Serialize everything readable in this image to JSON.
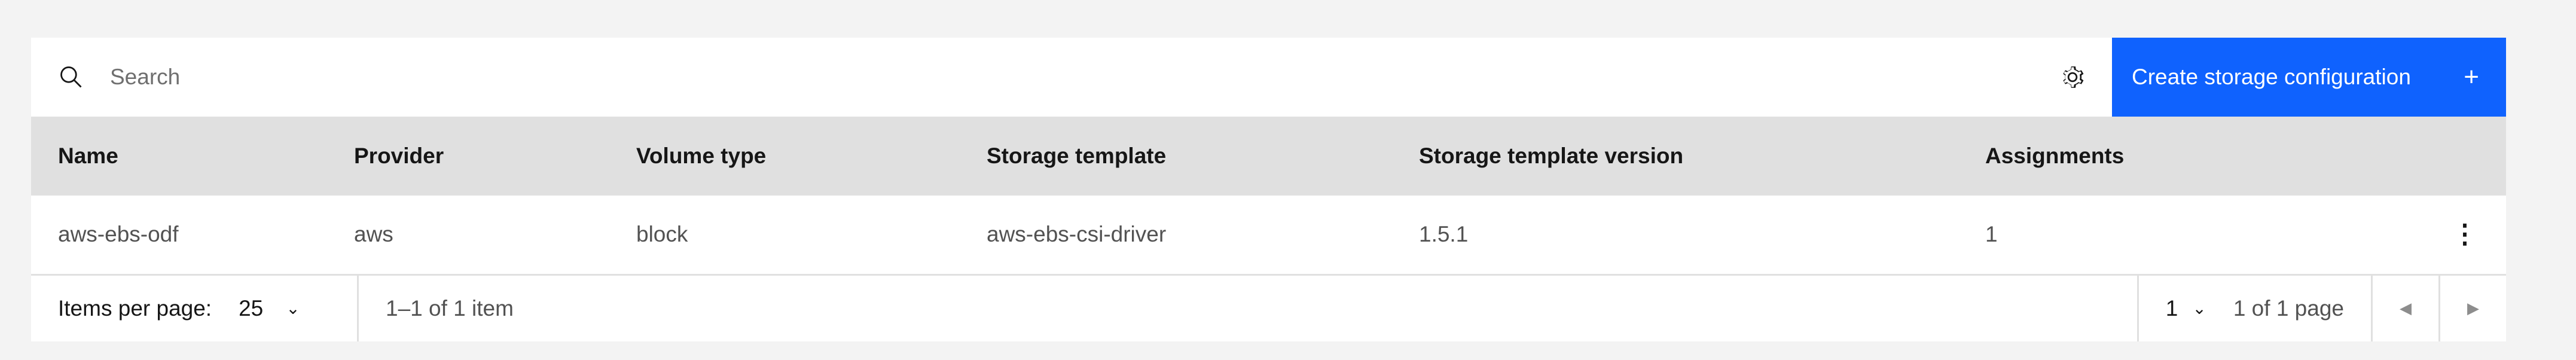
{
  "toolbar": {
    "search_placeholder": "Search",
    "create_label": "Create storage configuration",
    "create_icon": "plus-icon",
    "settings_icon": "gear-icon",
    "search_icon": "search-icon"
  },
  "table": {
    "headers": [
      "Name",
      "Provider",
      "Volume type",
      "Storage template",
      "Storage template version",
      "Assignments"
    ],
    "rows": [
      {
        "name": "aws-ebs-odf",
        "provider": "aws",
        "volume_type": "block",
        "storage_template": "aws-ebs-csi-driver",
        "template_version": "1.5.1",
        "assignments": "1",
        "overflow_icon": "overflow-menu-icon"
      }
    ]
  },
  "pagination": {
    "items_per_page_label": "Items per page:",
    "items_per_page_value": "25",
    "range_text": "1–1 of 1 item",
    "current_page": "1",
    "page_of_text": "1 of 1 page"
  },
  "colors": {
    "primary": "#0f62fe",
    "header_bg": "#e0e0e0",
    "page_bg": "#f3f3f3"
  }
}
